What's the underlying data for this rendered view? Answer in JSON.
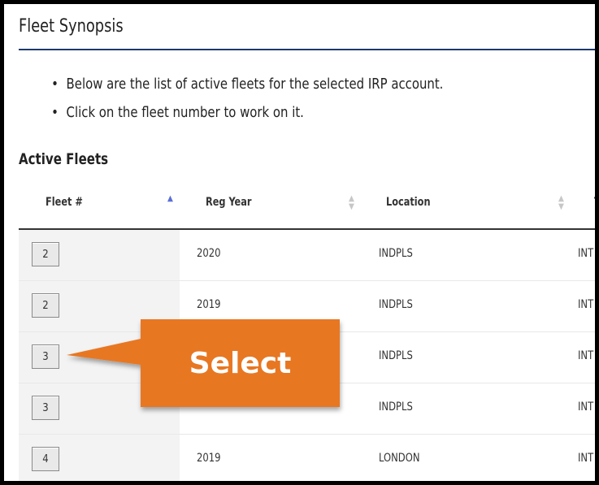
{
  "page": {
    "title": "Fleet Synopsis",
    "bullets": [
      "Below are the list of active fleets for the selected IRP account.",
      "Click on the fleet number to work on it."
    ],
    "section_title": "Active Fleets"
  },
  "table": {
    "columns": [
      "Fleet #",
      "Reg Year",
      "Location",
      "T"
    ],
    "rows": [
      {
        "fleet": "2",
        "reg_year": "2020",
        "location": "INDPLS",
        "type": "INT"
      },
      {
        "fleet": "2",
        "reg_year": "2019",
        "location": "INDPLS",
        "type": "INT"
      },
      {
        "fleet": "3",
        "reg_year": "",
        "location": "INDPLS",
        "type": "INT"
      },
      {
        "fleet": "3",
        "reg_year": "",
        "location": "INDPLS",
        "type": "INT"
      },
      {
        "fleet": "4",
        "reg_year": "2019",
        "location": "LONDON",
        "type": "INT"
      }
    ]
  },
  "callout": {
    "label": "Select",
    "color": "#e87722"
  },
  "colors": {
    "title_rule": "#1d3a6e",
    "sort_active": "#5a6fd6"
  }
}
